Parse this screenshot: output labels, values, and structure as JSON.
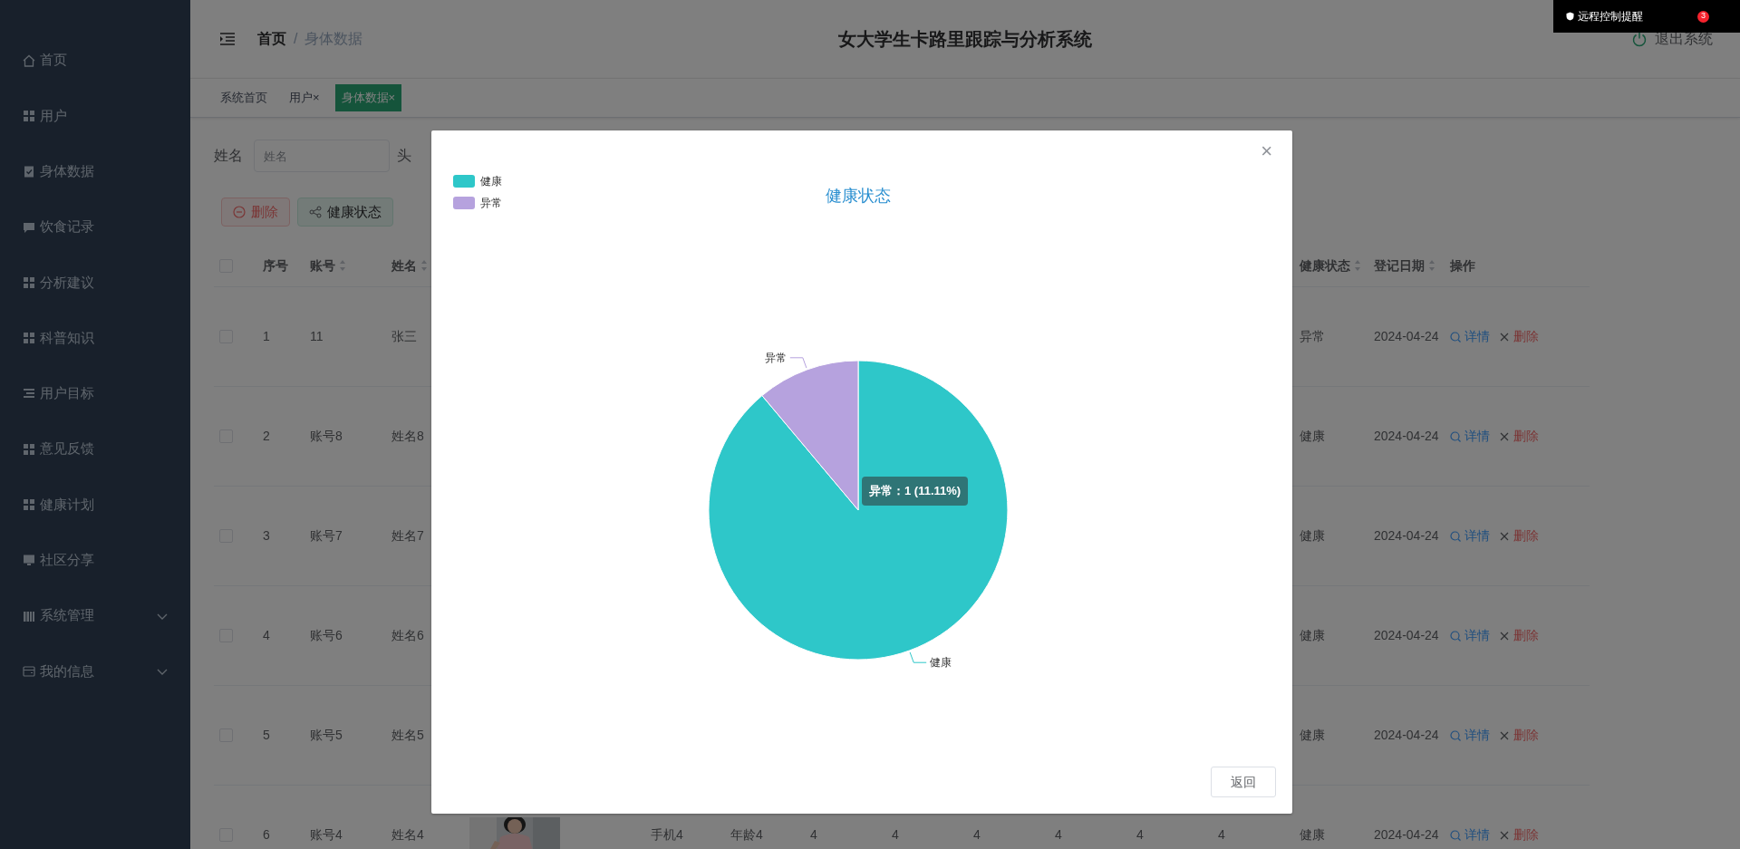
{
  "sidebar": {
    "items": [
      {
        "label": "首页",
        "kind": "link"
      },
      {
        "label": "用户",
        "kind": "link"
      },
      {
        "label": "身体数据",
        "kind": "link"
      },
      {
        "label": "饮食记录",
        "kind": "link"
      },
      {
        "label": "分析建议",
        "kind": "link"
      },
      {
        "label": "科普知识",
        "kind": "link"
      },
      {
        "label": "用户目标",
        "kind": "link"
      },
      {
        "label": "意见反馈",
        "kind": "link"
      },
      {
        "label": "健康计划",
        "kind": "link"
      },
      {
        "label": "社区分享",
        "kind": "link"
      },
      {
        "label": "系统管理",
        "kind": "submenu"
      },
      {
        "label": "我的信息",
        "kind": "submenu"
      }
    ]
  },
  "header": {
    "breadcrumb": [
      "首页",
      "身体数据"
    ],
    "breadcrumb_separator": "/",
    "title": "女大学生卡路里跟踪与分析系统",
    "logout": "退出系统"
  },
  "tabs": [
    {
      "label": "系统首页",
      "selected": false
    },
    {
      "label": "用户",
      "close": "×",
      "selected": false
    },
    {
      "label": "身体数据",
      "close": "×",
      "selected": true
    }
  ],
  "search": {
    "label": "姓名",
    "placeholder": "姓名",
    "next_label": "头"
  },
  "toolbar": [
    {
      "label": "删除",
      "kind": "delete"
    },
    {
      "label": "健康状态",
      "kind": "chart"
    }
  ],
  "table": {
    "all_checked": false,
    "columns": [
      {
        "label": "序号",
        "sortable": false
      },
      {
        "label": "账号",
        "sortable": true
      },
      {
        "label": "姓名",
        "sortable": true
      },
      {
        "label": "健康状态",
        "sortable": true
      },
      {
        "label": "登记日期",
        "sortable": true
      },
      {
        "label": "操作",
        "sortable": false
      }
    ],
    "rows": [
      {
        "checked": false,
        "no": "1",
        "account": "11",
        "name": "张三",
        "status": "异常",
        "date": "2024-04-24",
        "actions": [
          "详情",
          "删除"
        ]
      },
      {
        "checked": false,
        "no": "2",
        "account": "账号8",
        "name": "姓名8",
        "status": "健康",
        "date": "2024-04-24",
        "actions": [
          "详情",
          "删除"
        ]
      },
      {
        "checked": false,
        "no": "3",
        "account": "账号7",
        "name": "姓名7",
        "status": "健康",
        "date": "2024-04-24",
        "actions": [
          "详情",
          "删除"
        ]
      },
      {
        "checked": false,
        "no": "4",
        "account": "账号6",
        "name": "姓名6",
        "status": "健康",
        "date": "2024-04-24",
        "actions": [
          "详情",
          "删除"
        ]
      },
      {
        "checked": false,
        "no": "5",
        "account": "账号5",
        "name": "姓名5",
        "status": "健康",
        "date": "2024-04-24",
        "actions": [
          "详情",
          "删除"
        ]
      },
      {
        "checked": false,
        "no": "6",
        "account": "账号4",
        "name": "姓名4",
        "photo": {
          "kind": "picture"
        },
        "middle_cells": [
          "手机4",
          "年龄4",
          "4",
          "4",
          "4",
          "4",
          "4",
          "4"
        ],
        "status": "健康",
        "date": "2024-04-24",
        "actions": [
          "详情",
          "删除"
        ]
      }
    ]
  },
  "modal": {
    "close": "×",
    "legend": [
      {
        "label": "健康",
        "color": "#2ec7c9"
      },
      {
        "label": "异常",
        "color": "#b6a2de"
      }
    ],
    "chart_data": {
      "type": "pie",
      "title": "健康状态",
      "categories": [
        "健康",
        "异常"
      ],
      "series": [
        {
          "values": [
            88.89,
            11.11
          ]
        }
      ]
    },
    "tooltip": "异常：1 (11.11%)",
    "button": "返回"
  },
  "notification": {
    "title": "远程控制提醒",
    "count": "3"
  }
}
